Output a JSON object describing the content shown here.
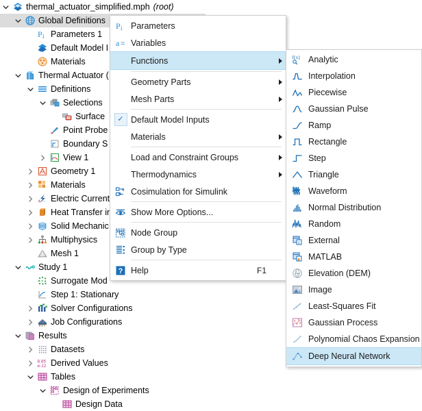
{
  "tree": {
    "items": [
      {
        "label": "thermal_actuator_simplified.mph",
        "note": "(root)",
        "indent": 0,
        "twist": "v",
        "icon": "comsol-root-icon",
        "selected": false
      },
      {
        "label": "Global Definitions",
        "note": "",
        "indent": 1,
        "twist": "v",
        "icon": "globe-icon",
        "selected": true
      },
      {
        "label": "Parameters 1",
        "note": "",
        "indent": 2,
        "twist": "",
        "icon": "parameters-icon",
        "selected": false
      },
      {
        "label": "Default Model I",
        "note": "",
        "indent": 2,
        "twist": "",
        "icon": "default-model-inputs-icon",
        "selected": false
      },
      {
        "label": "Materials",
        "note": "",
        "indent": 2,
        "twist": "",
        "icon": "materials-global-icon",
        "selected": false
      },
      {
        "label": "Thermal Actuator (",
        "note": "",
        "indent": 1,
        "twist": "v",
        "icon": "component-icon",
        "selected": false
      },
      {
        "label": "Definitions",
        "note": "",
        "indent": 2,
        "twist": "v",
        "icon": "definitions-icon",
        "selected": false
      },
      {
        "label": "Selections",
        "note": "",
        "indent": 3,
        "twist": "v",
        "icon": "selections-icon",
        "selected": false
      },
      {
        "label": "Surface",
        "note": "",
        "indent": 4,
        "twist": "",
        "icon": "surface-selection-icon",
        "selected": false
      },
      {
        "label": "Point Probe",
        "note": "",
        "indent": 3,
        "twist": "",
        "icon": "point-probe-icon",
        "selected": false
      },
      {
        "label": "Boundary S",
        "note": "",
        "indent": 3,
        "twist": "",
        "icon": "boundary-system-icon",
        "selected": false
      },
      {
        "label": "View 1",
        "note": "",
        "indent": 3,
        "twist": ">",
        "icon": "view-icon",
        "selected": false
      },
      {
        "label": "Geometry 1",
        "note": "",
        "indent": 2,
        "twist": ">",
        "icon": "geometry-icon",
        "selected": false
      },
      {
        "label": "Materials",
        "note": "",
        "indent": 2,
        "twist": ">",
        "icon": "materials-icon",
        "selected": false
      },
      {
        "label": "Electric Current",
        "note": "",
        "indent": 2,
        "twist": ">",
        "icon": "electric-currents-icon",
        "selected": false
      },
      {
        "label": "Heat Transfer in",
        "note": "",
        "indent": 2,
        "twist": ">",
        "icon": "heat-transfer-icon",
        "selected": false
      },
      {
        "label": "Solid Mechanic",
        "note": "",
        "indent": 2,
        "twist": ">",
        "icon": "solid-mechanics-icon",
        "selected": false
      },
      {
        "label": "Multiphysics",
        "note": "",
        "indent": 2,
        "twist": ">",
        "icon": "multiphysics-icon",
        "selected": false
      },
      {
        "label": "Mesh 1",
        "note": "",
        "indent": 2,
        "twist": "",
        "icon": "mesh-icon",
        "selected": false
      },
      {
        "label": "Study 1",
        "note": "",
        "indent": 1,
        "twist": "v",
        "icon": "study-icon",
        "selected": false
      },
      {
        "label": "Surrogate Mod",
        "note": "",
        "indent": 2,
        "twist": "",
        "icon": "surrogate-model-icon",
        "selected": false
      },
      {
        "label": "Step 1: Stationary",
        "note": "",
        "indent": 2,
        "twist": "",
        "icon": "stationary-step-icon",
        "selected": false
      },
      {
        "label": "Solver Configurations",
        "note": "",
        "indent": 2,
        "twist": ">",
        "icon": "solver-configurations-icon",
        "selected": false
      },
      {
        "label": "Job Configurations",
        "note": "",
        "indent": 2,
        "twist": ">",
        "icon": "job-configurations-icon",
        "selected": false
      },
      {
        "label": "Results",
        "note": "",
        "indent": 1,
        "twist": "v",
        "icon": "results-icon",
        "selected": false
      },
      {
        "label": "Datasets",
        "note": "",
        "indent": 2,
        "twist": ">",
        "icon": "datasets-icon",
        "selected": false
      },
      {
        "label": "Derived Values",
        "note": "",
        "indent": 2,
        "twist": ">",
        "icon": "derived-values-icon",
        "selected": false
      },
      {
        "label": "Tables",
        "note": "",
        "indent": 2,
        "twist": "v",
        "icon": "tables-icon",
        "selected": false
      },
      {
        "label": "Design of Experiments",
        "note": "",
        "indent": 3,
        "twist": "v",
        "icon": "design-of-experiments-icon",
        "selected": false
      },
      {
        "label": "Design Data",
        "note": "",
        "indent": 4,
        "twist": "",
        "icon": "design-data-icon",
        "selected": false
      }
    ]
  },
  "context_menu": {
    "items": [
      {
        "label": "Parameters",
        "icon": "parameters-icon",
        "arrow": false,
        "check": false,
        "highlight": false,
        "accel": "",
        "sep_after": false
      },
      {
        "label": "Variables",
        "icon": "variables-icon",
        "arrow": false,
        "check": false,
        "highlight": false,
        "accel": "",
        "sep_after": false
      },
      {
        "label": "Functions",
        "icon": "",
        "arrow": true,
        "check": false,
        "highlight": true,
        "accel": "",
        "sep_after": true
      },
      {
        "label": "Geometry Parts",
        "icon": "",
        "arrow": true,
        "check": false,
        "highlight": false,
        "accel": "",
        "sep_after": false
      },
      {
        "label": "Mesh Parts",
        "icon": "",
        "arrow": true,
        "check": false,
        "highlight": false,
        "accel": "",
        "sep_after": true
      },
      {
        "label": "Default Model Inputs",
        "icon": "",
        "arrow": false,
        "check": true,
        "highlight": false,
        "accel": "",
        "sep_after": false
      },
      {
        "label": "Materials",
        "icon": "",
        "arrow": true,
        "check": false,
        "highlight": false,
        "accel": "",
        "sep_after": true
      },
      {
        "label": "Load and Constraint Groups",
        "icon": "",
        "arrow": true,
        "check": false,
        "highlight": false,
        "accel": "",
        "sep_after": false
      },
      {
        "label": "Thermodynamics",
        "icon": "",
        "arrow": true,
        "check": false,
        "highlight": false,
        "accel": "",
        "sep_after": false
      },
      {
        "label": "Cosimulation for Simulink",
        "icon": "cosimulation-icon",
        "arrow": false,
        "check": false,
        "highlight": false,
        "accel": "",
        "sep_after": true
      },
      {
        "label": "Show More Options...",
        "icon": "show-more-options-icon",
        "arrow": false,
        "check": false,
        "highlight": false,
        "accel": "",
        "sep_after": true
      },
      {
        "label": "Node Group",
        "icon": "node-group-icon",
        "arrow": false,
        "check": false,
        "highlight": false,
        "accel": "",
        "sep_after": false
      },
      {
        "label": "Group by Type",
        "icon": "group-by-type-icon",
        "arrow": false,
        "check": false,
        "highlight": false,
        "accel": "",
        "sep_after": true
      },
      {
        "label": "Help",
        "icon": "help-icon",
        "arrow": false,
        "check": false,
        "highlight": false,
        "accel": "F1",
        "sep_after": false
      }
    ]
  },
  "functions_submenu": {
    "items": [
      {
        "label": "Analytic",
        "icon": "analytic-icon",
        "highlight": false
      },
      {
        "label": "Interpolation",
        "icon": "interpolation-icon",
        "highlight": false
      },
      {
        "label": "Piecewise",
        "icon": "piecewise-icon",
        "highlight": false
      },
      {
        "label": "Gaussian Pulse",
        "icon": "gaussian-pulse-icon",
        "highlight": false
      },
      {
        "label": "Ramp",
        "icon": "ramp-icon",
        "highlight": false
      },
      {
        "label": "Rectangle",
        "icon": "rectangle-icon",
        "highlight": false
      },
      {
        "label": "Step",
        "icon": "step-icon",
        "highlight": false
      },
      {
        "label": "Triangle",
        "icon": "triangle-icon",
        "highlight": false
      },
      {
        "label": "Waveform",
        "icon": "waveform-icon",
        "highlight": false
      },
      {
        "label": "Normal Distribution",
        "icon": "normal-distribution-icon",
        "highlight": false
      },
      {
        "label": "Random",
        "icon": "random-icon",
        "highlight": false
      },
      {
        "label": "External",
        "icon": "external-icon",
        "highlight": false
      },
      {
        "label": "MATLAB",
        "icon": "matlab-icon",
        "highlight": false
      },
      {
        "label": "Elevation (DEM)",
        "icon": "elevation-dem-icon",
        "highlight": false
      },
      {
        "label": "Image",
        "icon": "image-icon",
        "highlight": false
      },
      {
        "label": "Least-Squares Fit",
        "icon": "least-squares-fit-icon",
        "highlight": false
      },
      {
        "label": "Gaussian Process",
        "icon": "gaussian-process-icon",
        "highlight": false
      },
      {
        "label": "Polynomial Chaos Expansion",
        "icon": "polynomial-chaos-icon",
        "highlight": false
      },
      {
        "label": "Deep Neural Network",
        "icon": "deep-neural-network-icon",
        "highlight": true
      }
    ]
  },
  "colors": {
    "highlight": "#cce8f7",
    "tree_selection": "#dcdcdc",
    "icon_blue": "#1c6fb8",
    "icon_orange": "#e8923a",
    "icon_magenta": "#b4378f",
    "icon_green": "#2f9e44"
  }
}
